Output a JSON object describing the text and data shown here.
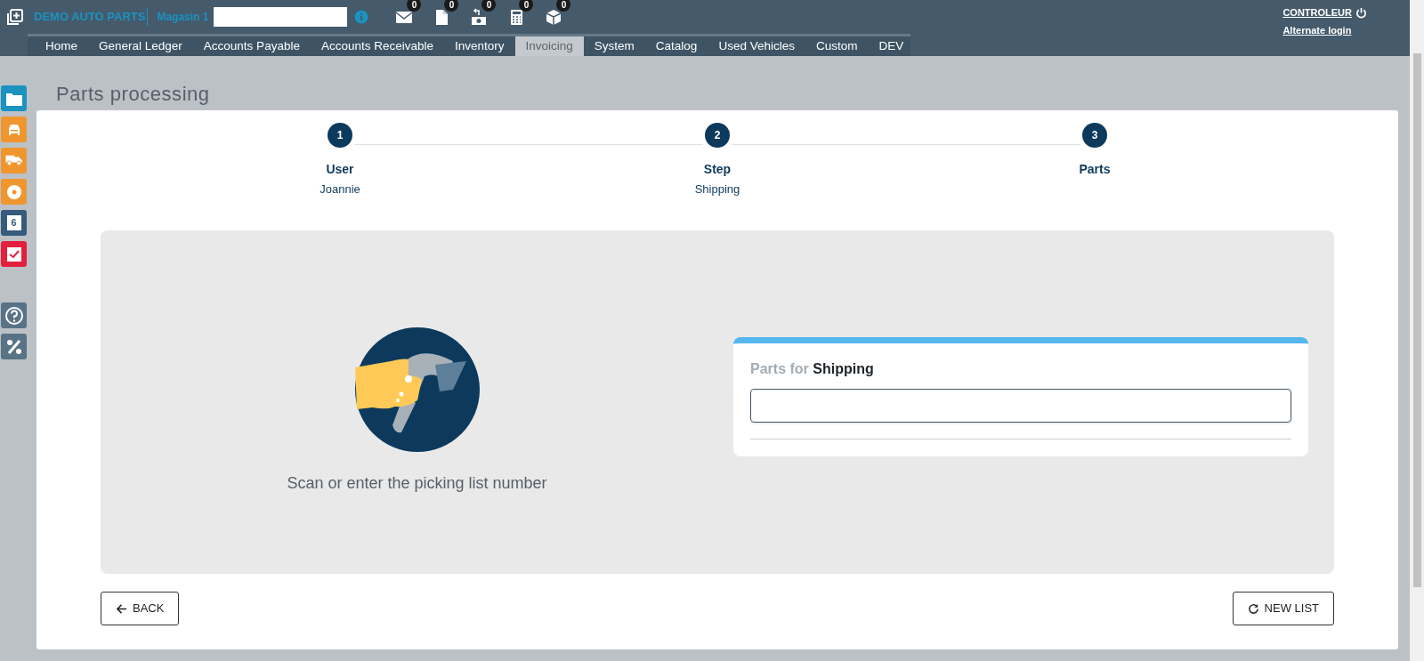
{
  "header": {
    "brand": "DEMO AUTO PARTS",
    "store": "Magasin 1",
    "notifications": [
      {
        "kind": "mail",
        "count": "0"
      },
      {
        "kind": "document",
        "count": "0"
      },
      {
        "kind": "return",
        "count": "0"
      },
      {
        "kind": "calculator",
        "count": "0"
      },
      {
        "kind": "package",
        "count": "0"
      }
    ],
    "user": "CONTROLEUR",
    "alternate_login": "Alternate login"
  },
  "nav": [
    {
      "label": "Home",
      "selected": false
    },
    {
      "label": "General Ledger",
      "selected": false
    },
    {
      "label": "Accounts Payable",
      "selected": false
    },
    {
      "label": "Accounts Receivable",
      "selected": false
    },
    {
      "label": "Inventory",
      "selected": false
    },
    {
      "label": "Invoicing",
      "selected": true
    },
    {
      "label": "System",
      "selected": false
    },
    {
      "label": "Catalog",
      "selected": false
    },
    {
      "label": "Used Vehicles",
      "selected": false
    },
    {
      "label": "Custom",
      "selected": false
    },
    {
      "label": "DEV",
      "selected": false
    }
  ],
  "sidebar": {
    "items": [
      {
        "kind": "folder",
        "color": "#1b93c0"
      },
      {
        "kind": "car",
        "color": "#f0962e"
      },
      {
        "kind": "truck",
        "color": "#f0962e"
      },
      {
        "kind": "disc",
        "color": "#f0962e"
      },
      {
        "kind": "calendar",
        "color": "#365b7c",
        "text": "6"
      },
      {
        "kind": "check",
        "color": "#e3203d"
      }
    ],
    "tools": [
      {
        "kind": "help"
      },
      {
        "kind": "percent"
      }
    ]
  },
  "page_title": "Parts processing",
  "steps": [
    {
      "number": "1",
      "title": "User",
      "subtitle": "Joannie"
    },
    {
      "number": "2",
      "title": "Step",
      "subtitle": "Shipping"
    },
    {
      "number": "3",
      "title": "Parts"
    }
  ],
  "prompt": "Scan or enter the picking list number",
  "card": {
    "title": "Parts for **Shipping**"
  },
  "buttons": [
    {
      "kind": "back",
      "label": "BACK"
    },
    {
      "kind": "new",
      "label": "NEW LIST"
    }
  ]
}
